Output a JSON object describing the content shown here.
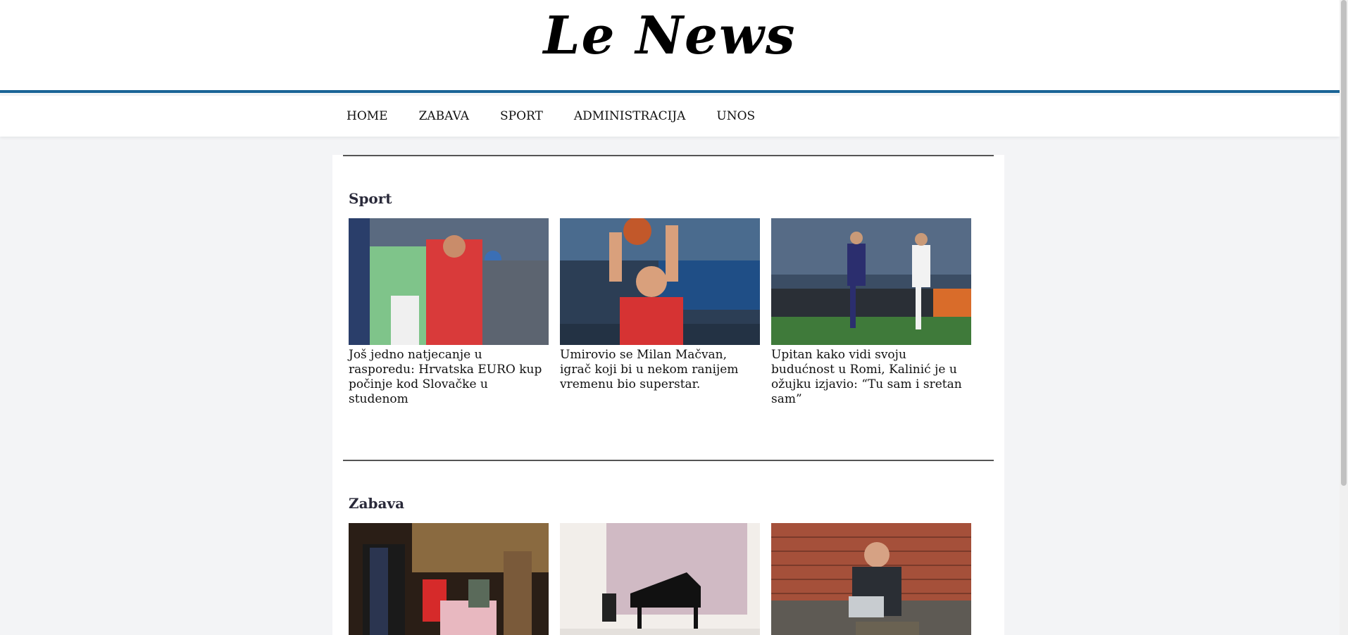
{
  "site": {
    "title": "Le News"
  },
  "nav": {
    "items": [
      "HOME",
      "ZABAVA",
      "SPORT",
      "ADMINISTRACIJA",
      "UNOS"
    ]
  },
  "sections": [
    {
      "title": "Sport",
      "articles": [
        {
          "title": "Još jedno natjecanje u rasporedu: Hrvatska EURO kup počinje kod Slovačke u studenom"
        },
        {
          "title": "Umirovio se Milan Mačvan, igrač koji bi u nekom ranijem vremenu bio superstar."
        },
        {
          "title": "Upitan kako vidi svoju budućnost u Romi, Kalinić je u ožujku izjavio: “Tu sam i sretan sam”"
        }
      ]
    },
    {
      "title": "Zabava",
      "articles": [
        {
          "title": ""
        },
        {
          "title": ""
        },
        {
          "title": ""
        }
      ]
    }
  ],
  "images": {
    "sport_0": "handball-photo",
    "sport_1": "basketball-photo",
    "sport_2": "football-photo",
    "zabava_0": "theatre-photo",
    "zabava_1": "piano-photo",
    "zabava_2": "laptop-man-photo"
  },
  "colors": {
    "accent": "#1a6496",
    "background": "#f3f4f6"
  }
}
